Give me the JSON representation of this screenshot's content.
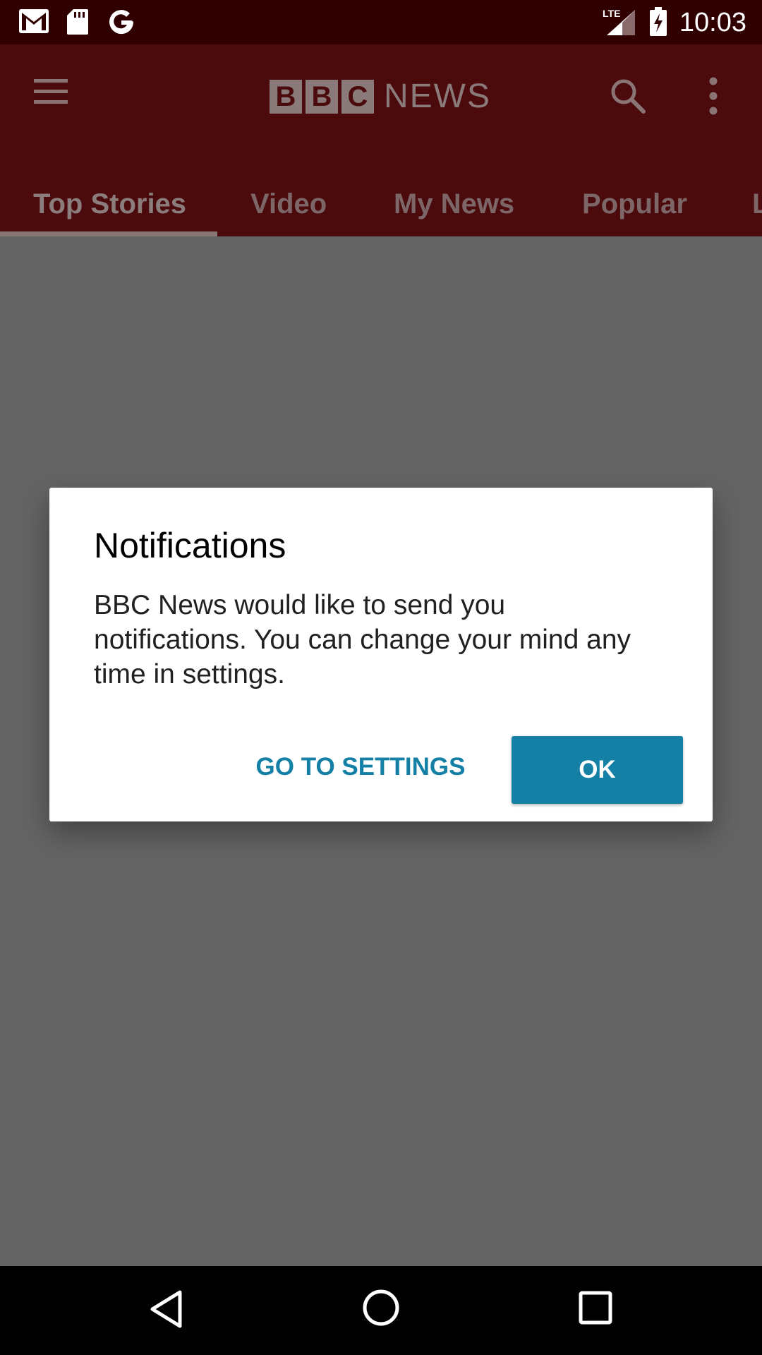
{
  "status_bar": {
    "time": "10:03",
    "icons": [
      "gmail-icon",
      "sd-card-icon",
      "google-icon",
      "lte-signal-icon",
      "battery-charging-icon"
    ],
    "network_label": "LTE"
  },
  "app_bar": {
    "logo_letters": [
      "B",
      "B",
      "C"
    ],
    "logo_text": "NEWS",
    "menu_icon": "hamburger-menu-icon",
    "search_icon": "search-icon",
    "overflow_icon": "more-vert-icon"
  },
  "tabs": [
    {
      "label": "Top Stories",
      "active": true
    },
    {
      "label": "Video",
      "active": false
    },
    {
      "label": "My News",
      "active": false
    },
    {
      "label": "Popular",
      "active": false
    },
    {
      "label": "L",
      "active": false
    }
  ],
  "dialog": {
    "title": "Notifications",
    "message": "BBC News would like to send you notifications. You can change your mind any time in settings.",
    "secondary_button": "GO TO SETTINGS",
    "primary_button": "OK"
  },
  "nav_bar": {
    "back_icon": "back-triangle-icon",
    "home_icon": "home-circle-icon",
    "recents_icon": "recents-square-icon"
  },
  "colors": {
    "status_bar": "#300000",
    "app_bar": "#4b0a0c",
    "accent": "#1480a6",
    "scrim_background": "#646464"
  }
}
